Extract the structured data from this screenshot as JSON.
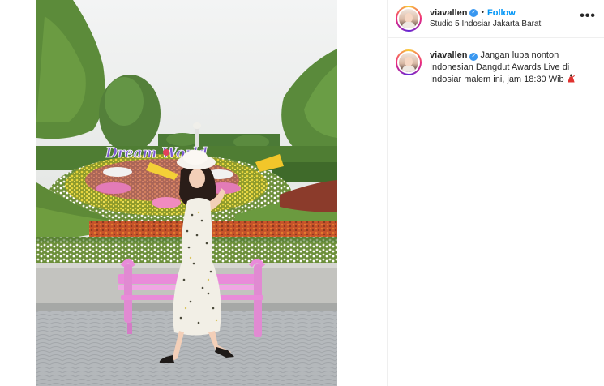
{
  "post": {
    "username": "viavallen",
    "follow_label": "Follow",
    "separator": "•",
    "location": "Studio 5 Indosiar Jakarta Barat",
    "more_label": "•••",
    "verified_mark": "✓"
  },
  "caption": {
    "username": "viavallen",
    "text": "Jangan lupa nonton Indonesian Dangdut Awards Live di Indosiar malem ini, jam 18:30 Wib",
    "emoji": "dancer-emoji"
  },
  "photo": {
    "sign_text": "Dream World"
  },
  "colors": {
    "follow": "#0095f6",
    "verified": "#3897f0",
    "bench": "#e98bd9",
    "sign": "#7d5ad1"
  }
}
